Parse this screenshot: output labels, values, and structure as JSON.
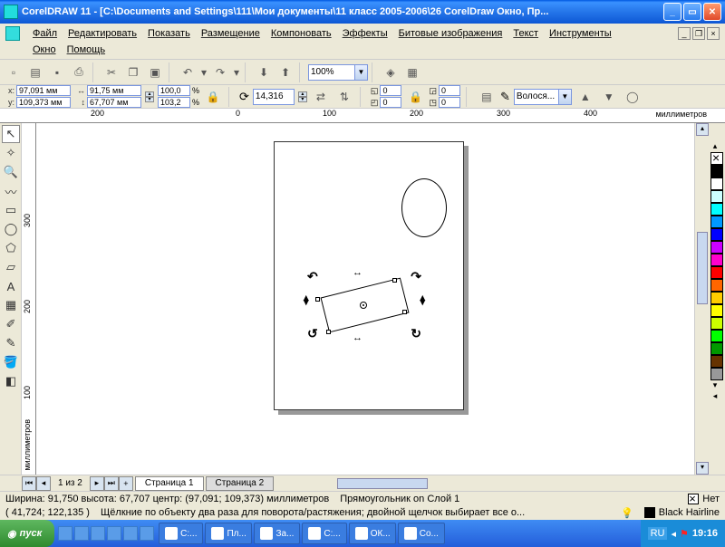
{
  "title": "CorelDRAW 11 - [C:\\Documents and Settings\\111\\Мои документы\\11 класс 2005-2006\\26 CorelDraw Окно, Пр...",
  "menu": [
    "Файл",
    "Редактировать",
    "Показать",
    "Размещение",
    "Компоновать",
    "Эффекты",
    "Битовые изображения",
    "Текст",
    "Инструменты",
    "Окно",
    "Помощь"
  ],
  "zoom": "100%",
  "prop": {
    "x": "97,091 мм",
    "y": "109,373 мм",
    "w": "91,75 мм",
    "h": "67,707 мм",
    "sx": "100,0",
    "sy": "103,2",
    "rot": "14,316",
    "rx1": "0",
    "ry1": "0",
    "rx2": "0",
    "ry2": "0",
    "outline": "Волося..."
  },
  "ruler_h": [
    "0",
    "100",
    "200",
    "300",
    "400"
  ],
  "ruler_h_left": "200",
  "ruler_units_h": "миллиметров",
  "ruler_v": [
    "100",
    "200",
    "300"
  ],
  "ruler_units_v": "миллиметров",
  "page_counter": "1 из 2",
  "page_tabs": [
    "Страница 1",
    "Страница 2"
  ],
  "status": {
    "dim": "Ширина: 91,750  высота: 67,707  центр: (97,091; 109,373)  миллиметров",
    "obj": "Прямоугольник on Слой 1",
    "fill": "Нет",
    "outline": "Black  Hairline",
    "coords": "( 41,724; 122,135 )",
    "hint": "Щёлкние по объекту два раза для поворота/растяжения; двойной щелчок выбирает все о..."
  },
  "palette": [
    "#000000",
    "#ffffff",
    "#ccffff",
    "#00ffff",
    "#0099ff",
    "#0000ff",
    "#cc00ff",
    "#ff00cc",
    "#ff0000",
    "#ff6600",
    "#ffcc00",
    "#ffff00",
    "#ccff00",
    "#00ff00",
    "#009900",
    "#663300",
    "#999999"
  ],
  "taskbar": {
    "start": "пуск",
    "items": [
      "C:...",
      "Пл...",
      "За...",
      "C:...",
      "ОК...",
      "Co..."
    ],
    "lang": "RU",
    "time": "19:16"
  }
}
